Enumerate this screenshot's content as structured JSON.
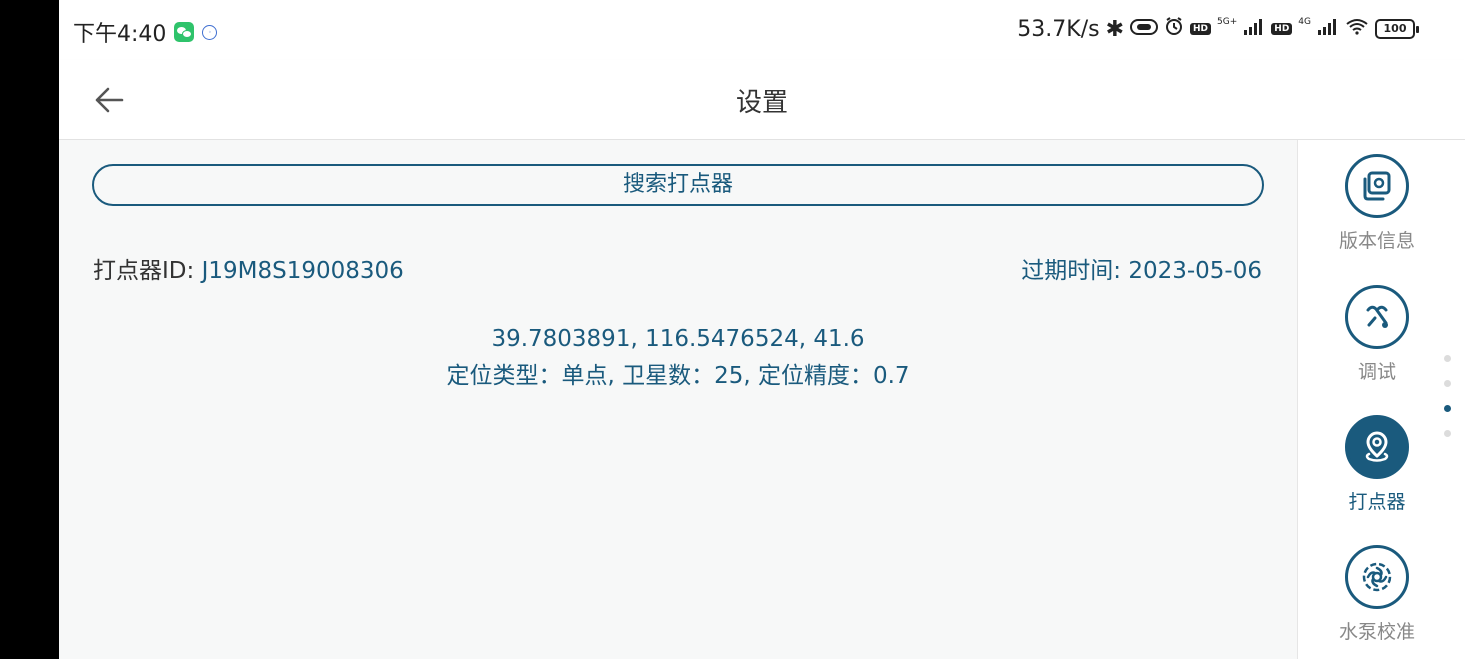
{
  "status_bar": {
    "time": "下午4:40",
    "net_speed": "53.7K/s",
    "signal1_label": "5G+",
    "signal2_label": "4G",
    "hd": "HD",
    "battery": "100"
  },
  "app_bar": {
    "title": "设置"
  },
  "main": {
    "search_button": "搜索打点器",
    "device_id_label": "打点器ID:",
    "device_id_value": "J19M8S19008306",
    "expire_label": "过期时间:",
    "expire_value": "2023-05-06",
    "coordinates": "39.7803891, 116.5476524, 41.6",
    "fix_info": "定位类型：单点, 卫星数：25, 定位精度：0.7"
  },
  "sidebar": {
    "items": [
      {
        "label": "版本信息",
        "icon": "version-info-icon",
        "active": false
      },
      {
        "label": "调试",
        "icon": "debug-icon",
        "active": false
      },
      {
        "label": "打点器",
        "icon": "location-marker-icon",
        "active": true
      },
      {
        "label": "水泵校准",
        "icon": "pump-icon",
        "active": false
      }
    ]
  },
  "page_indicator": {
    "count": 4,
    "active_index": 2
  },
  "colors": {
    "accent": "#1a5a7d",
    "background": "#f7f8f8"
  }
}
